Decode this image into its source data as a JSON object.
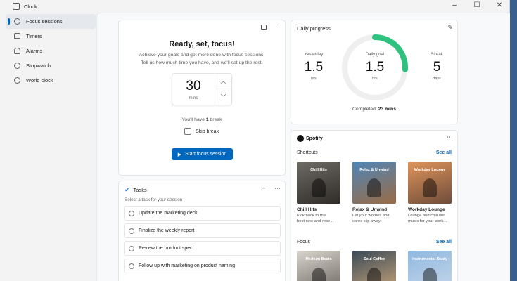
{
  "window": {
    "title": "Clock",
    "controls": [
      "–",
      "☐",
      "✕"
    ]
  },
  "sidebar": {
    "items": [
      {
        "label": "Focus sessions",
        "active": true
      },
      {
        "label": "Timers"
      },
      {
        "label": "Alarms"
      },
      {
        "label": "Stopwatch"
      },
      {
        "label": "World clock"
      }
    ]
  },
  "focus": {
    "title": "Ready, set, focus!",
    "description_line1": "Achieve your goals and get more done with focus sessions.",
    "description_line2": "Tell us how much time you have, and we'll set up the rest.",
    "minutes": "30",
    "minutes_unit": "mins",
    "break_prefix": "You'll have ",
    "break_count": "1",
    "break_suffix": " break",
    "skip_break_label": "Skip break",
    "start_label": "Start focus session"
  },
  "tasks": {
    "title": "Tasks",
    "subtitle": "Select a task for your session",
    "items": [
      "Update the marketing deck",
      "Finalize the weekly report",
      "Review the product spec",
      "Follow up with marketing on product naming"
    ]
  },
  "progress": {
    "title": "Daily progress",
    "yesterday": {
      "label": "Yesterday",
      "value": "1.5",
      "unit": "hrs"
    },
    "goal": {
      "label": "Daily goal",
      "value": "1.5",
      "unit": "hrs"
    },
    "streak": {
      "label": "Streak",
      "value": "5",
      "unit": "days"
    },
    "completed_prefix": "Completed: ",
    "completed_value": "23 mins",
    "completed_fraction": 0.26
  },
  "spotify": {
    "brand": "Spotify",
    "shortcuts_title": "Shortcuts",
    "focus_title": "Focus",
    "see_all": "See all",
    "shortcuts": [
      {
        "art_text": "Chill Hits",
        "name": "Chill Hits",
        "desc1": "Kick back to the",
        "desc2": "best new and rece...",
        "color1": "#6e6a64",
        "color2": "#2f2b28"
      },
      {
        "art_text": "Relax & Unwind",
        "name": "Relax & Unwind",
        "desc1": "Let your worries and",
        "desc2": "cares slip away.",
        "color1": "#4f86b8",
        "color2": "#9a6b45"
      },
      {
        "art_text": "Workday Lounge",
        "name": "Workday Lounge",
        "desc1": "Lounge and chill out",
        "desc2": "music for your work...",
        "color1": "#e0955b",
        "color2": "#6e4c3a"
      }
    ],
    "focus_items": [
      {
        "art_text": "Medium Beats",
        "color1": "#d9d4cc",
        "color2": "#6a6660"
      },
      {
        "art_text": "Soul Coffee",
        "color1": "#3c4a57",
        "color2": "#c9a67b"
      },
      {
        "art_text": "Instrumental Study",
        "color1": "#8fb8e0",
        "color2": "#c8d8ea"
      }
    ]
  },
  "colors": {
    "accent": "#0067c0",
    "progress_ring": "#2ec27e",
    "ring_track": "#efefef"
  }
}
